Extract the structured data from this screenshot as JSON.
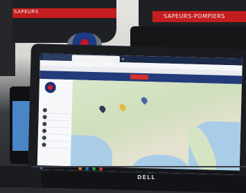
{
  "scene": {
    "left_uniform_text": "SAPEURS",
    "right_uniform_text": "SAPEURS-POMPIERS",
    "laptop_brand": "DELL"
  },
  "browser": {
    "tabs": [
      {
        "label": ""
      },
      {
        "label": ""
      }
    ],
    "add_tab_label": "+"
  },
  "colors": {
    "uniform_stripe": "#c41d1f",
    "app_header": "#233b7a",
    "sea": "#a9cde6",
    "land": "#d5e4c3"
  },
  "icons": [
    "emblem-icon",
    "map-marker-icon",
    "windows-icon"
  ]
}
